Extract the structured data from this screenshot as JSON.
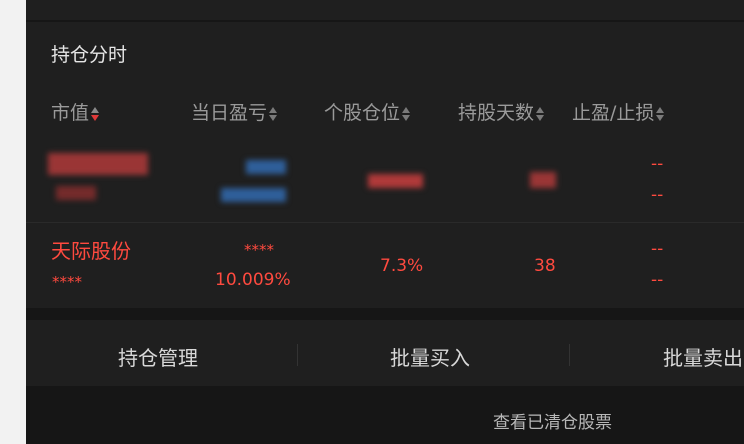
{
  "section_title": "持仓分时",
  "columns": [
    {
      "label": "市值"
    },
    {
      "label": "当日盈亏"
    },
    {
      "label": "个股仓位"
    },
    {
      "label": "持股天数"
    },
    {
      "label": "止盈/止损"
    }
  ],
  "row_redacted": {
    "stop_top": "--",
    "stop_bottom": "--"
  },
  "row_stock": {
    "name": "天际股份",
    "market_value": "****",
    "pnl_amount": "****",
    "pnl_percent": "10.009%",
    "position": "7.3%",
    "days_held": "38",
    "stop_top": "--",
    "stop_bottom": "--"
  },
  "actions": {
    "manage": "持仓管理",
    "batch_buy": "批量买入",
    "batch_sell": "批量卖出"
  },
  "footer": {
    "cleared_link": "查看已清仓股票"
  },
  "colors": {
    "positive": "#ff4a3f",
    "panel": "#1f1f1f",
    "background": "#161616"
  }
}
